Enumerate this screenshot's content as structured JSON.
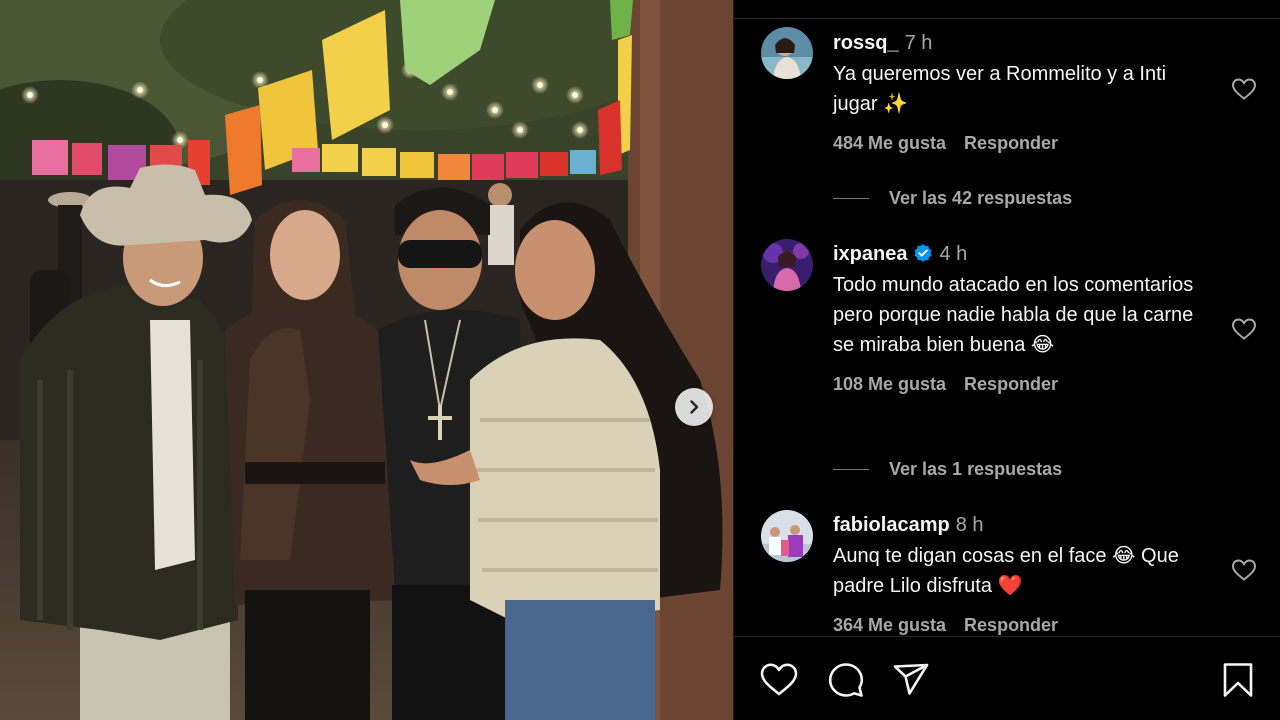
{
  "post": {
    "carousel_next_icon": "chevron-right-icon"
  },
  "comments": [
    {
      "username": "rossq_",
      "time": "7 h",
      "text": "Ya queremos ver a Rommelito y a Inti jugar ✨",
      "likes": "484 Me gusta",
      "reply_label": "Responder",
      "view_replies": "Ver las 42 respuestas",
      "verified": false
    },
    {
      "username": "ixpanea",
      "time": "4 h",
      "text": "Todo mundo atacado en los comentarios pero porque nadie habla de que la carne se miraba bien buena 😂",
      "likes": "108 Me gusta",
      "reply_label": "Responder",
      "view_replies": "Ver las 1 respuestas",
      "verified": true
    },
    {
      "username": "fabiolacamp",
      "time": "8 h",
      "text": "Aunq te digan cosas en el face 😂 Que padre Lilo disfruta ❤️",
      "likes": "364 Me gusta",
      "reply_label": "Responder",
      "verified": false
    }
  ],
  "actions": {
    "like_icon": "heart-icon",
    "comment_icon": "comment-bubble-icon",
    "share_icon": "paper-plane-icon",
    "save_icon": "bookmark-icon"
  },
  "colors": {
    "background": "#000000",
    "text_primary": "#f5f5f5",
    "text_secondary": "#a8a8a8",
    "verified_blue": "#0095f6",
    "divider": "#262626"
  }
}
